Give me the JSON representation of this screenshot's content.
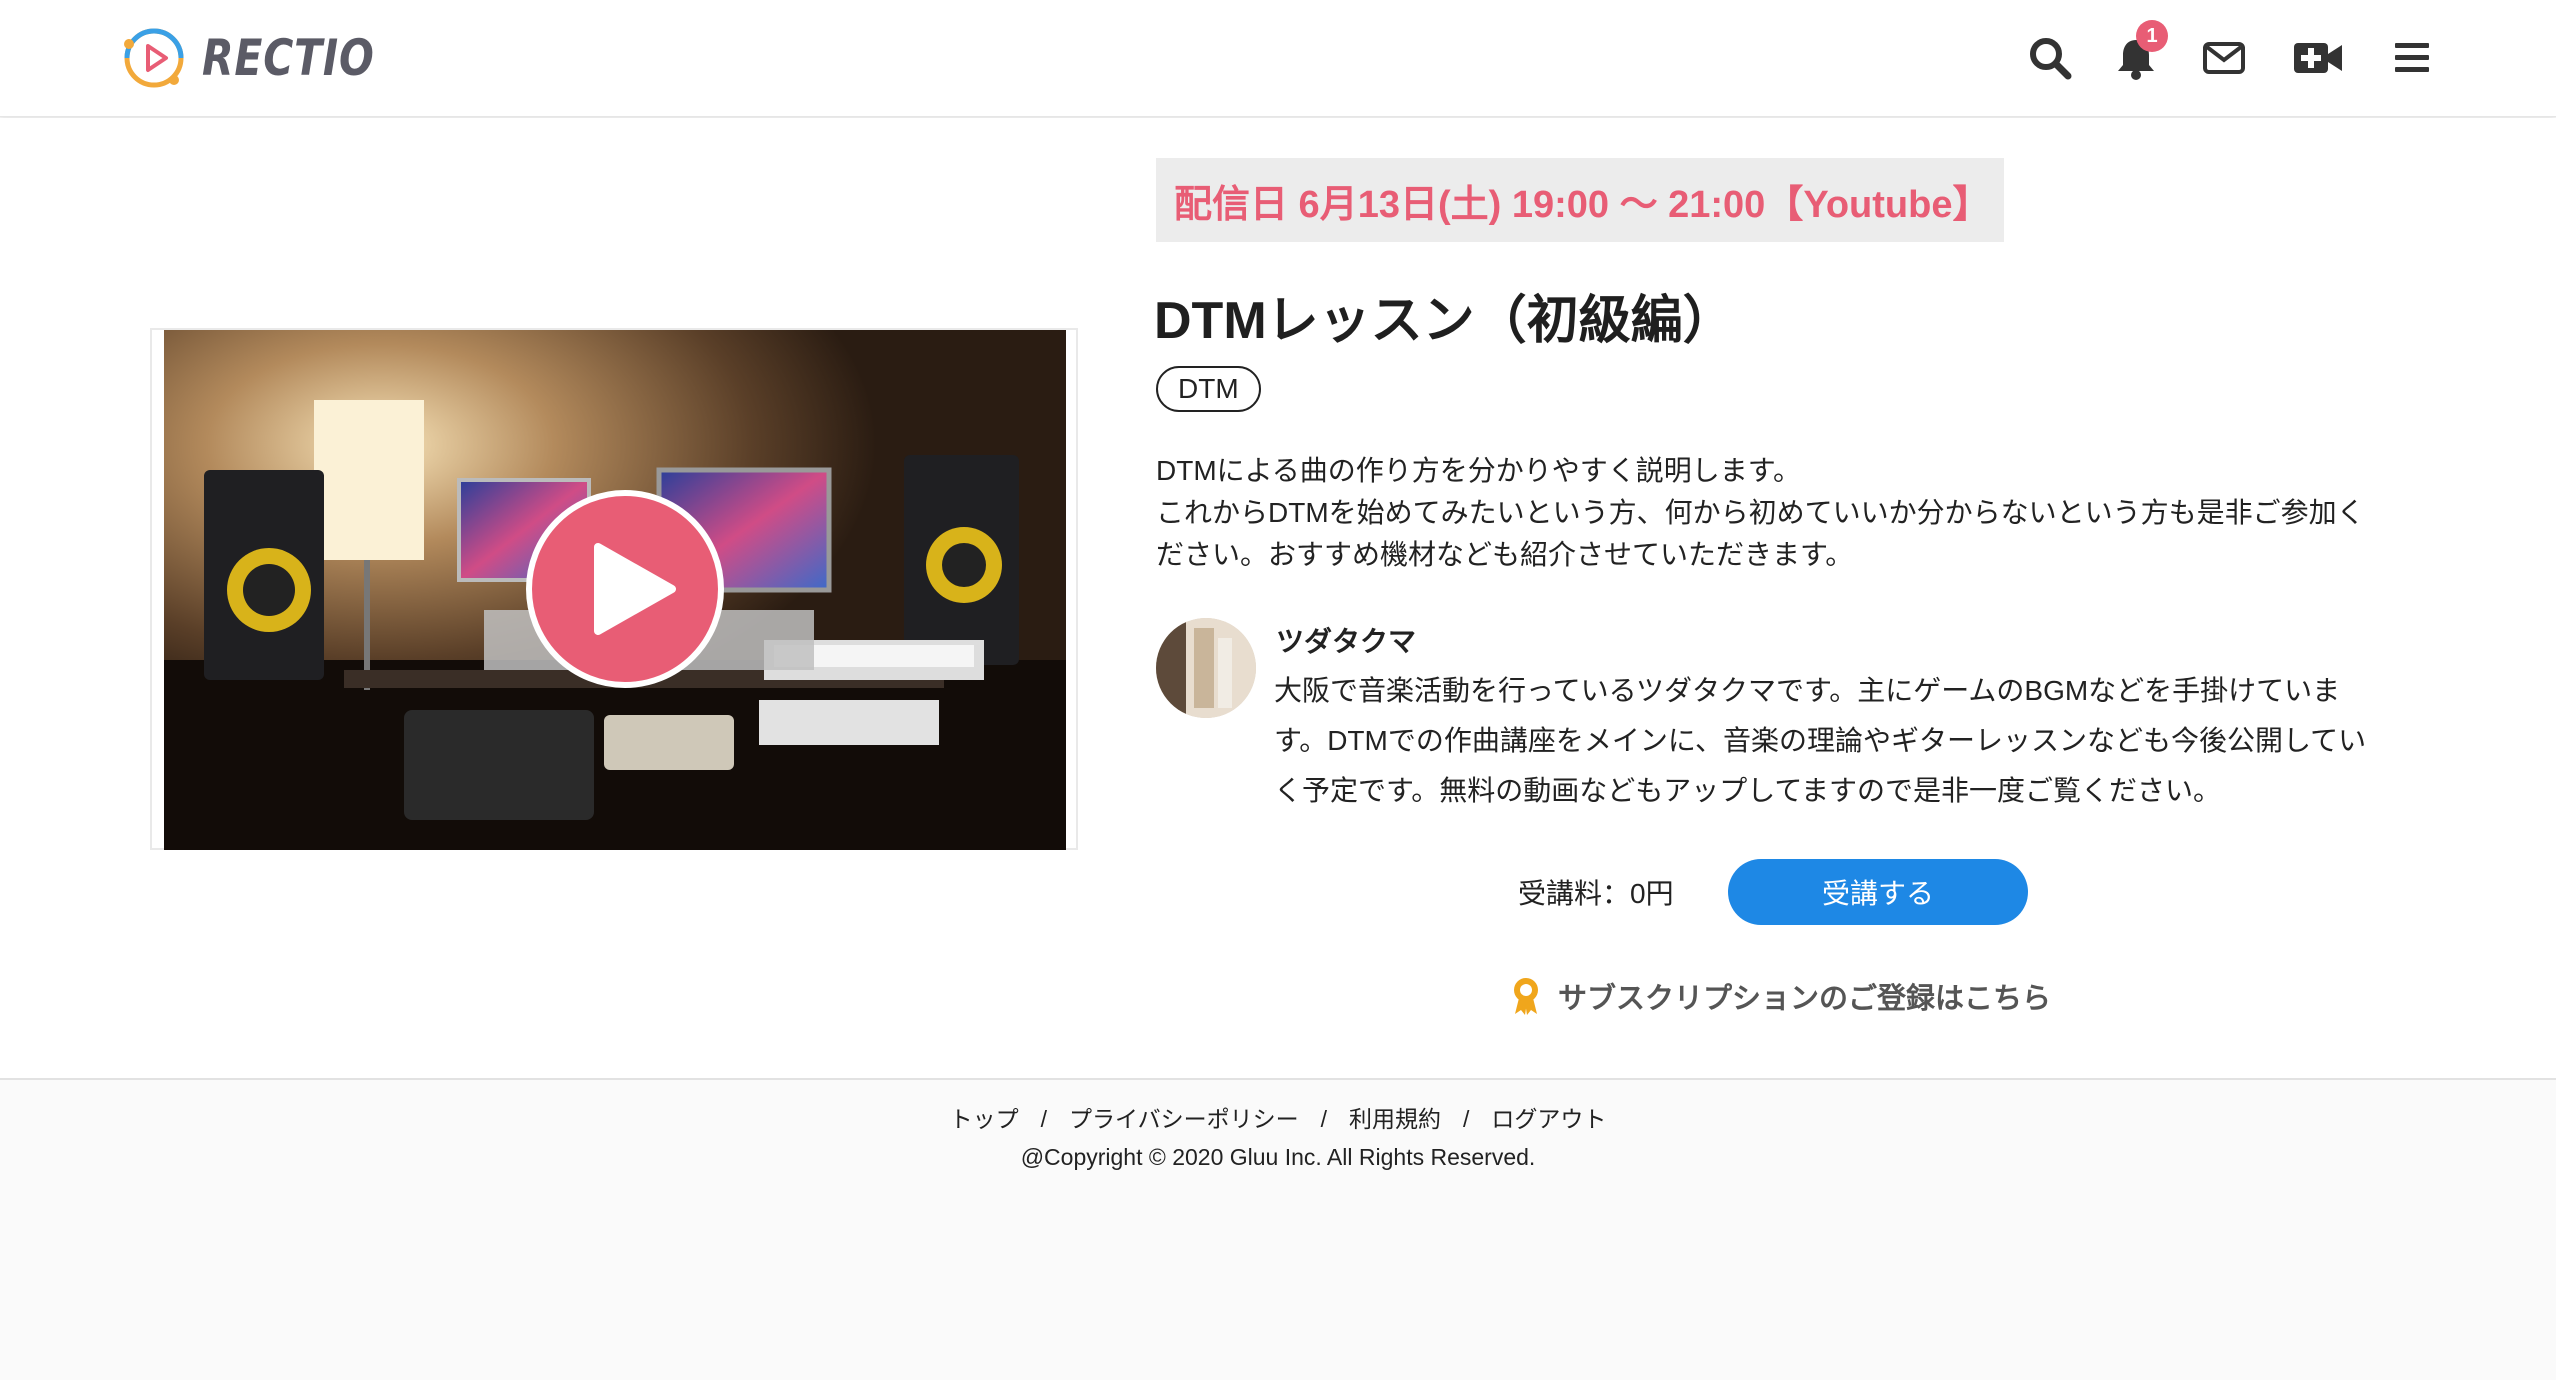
{
  "header": {
    "logo_text": "RECTIO",
    "notification_count": "1",
    "icons": [
      "search-icon",
      "bell-icon",
      "mail-icon",
      "video-plus-icon",
      "menu-icon"
    ]
  },
  "event": {
    "date_banner": "配信日 6月13日(土) 19:00 〜 21:00【Youtube】",
    "title": "DTMレッスン（初級編）",
    "tag": "DTM",
    "description": "DTMによる曲の作り方を分かりやすく説明します。\nこれからDTMを始めてみたいという方、何から初めていいか分からないという方も是非ご参加ください。おすすめ機材なども紹介させていただきます。",
    "fee_label": "受講料：0円",
    "enroll_label": "受講する",
    "subscription_link": "サブスクリプションのご登録はこちら"
  },
  "instructor": {
    "name": "ツダタクマ",
    "bio": "大阪で音楽活動を行っているツダタクマです。主にゲームのBGMなどを手掛けています。DTMでの作曲講座をメインに、音楽の理論やギターレッスンなども今後公開していく予定です。無料の動画などもアップしてますので是非一度ご覧ください。"
  },
  "footer": {
    "links": [
      "トップ",
      "プライバシーポリシー",
      "利用規約",
      "ログアウト"
    ],
    "separator": "/",
    "copyright": "@Copyright © 2020 Gluu Inc. All Rights Reserved."
  },
  "colors": {
    "accent": "#e85d75",
    "button": "#1e88e5",
    "banner_bg": "#ececec"
  }
}
